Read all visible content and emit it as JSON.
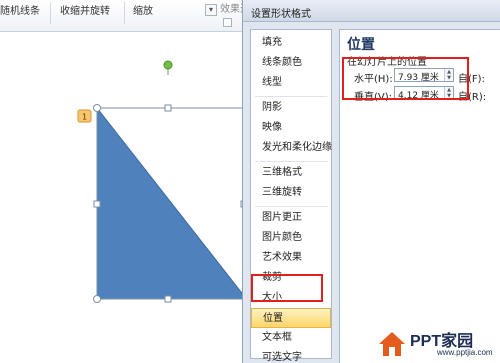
{
  "ribbon": {
    "items": [
      "随机线条",
      "收缩并旋转",
      "缩放"
    ],
    "effect_options": "效果选项",
    "dropdown_glyph": "▾"
  },
  "canvas": {
    "shape_fill": "#4f81bd",
    "shape_stroke": "#3a6aa3",
    "rotation_handle_color": "#72c041",
    "badge": "1"
  },
  "dialog": {
    "title": "设置形状格式",
    "nav_items": [
      "填充",
      "线条颜色",
      "线型",
      "阴影",
      "映像",
      "发光和柔化边缘",
      "三维格式",
      "三维旋转",
      "图片更正",
      "图片颜色",
      "艺术效果",
      "裁剪",
      "大小",
      "位置",
      "文本框",
      "可选文字"
    ],
    "selected": "位置",
    "panel": {
      "title": "位置",
      "section": "在幻灯片上的位置",
      "horizontal": {
        "label": "水平(H):",
        "value": "7.93 厘米",
        "from": "自(F):"
      },
      "vertical": {
        "label": "垂直(V):",
        "value": "4.12 厘米",
        "from": "自(R):"
      }
    }
  },
  "watermark": {
    "brand": "PPT家园",
    "url": "www.pptjia.com"
  },
  "colors": {
    "highlight_red": "#e0201b",
    "accent_blue": "#4f81bd"
  }
}
